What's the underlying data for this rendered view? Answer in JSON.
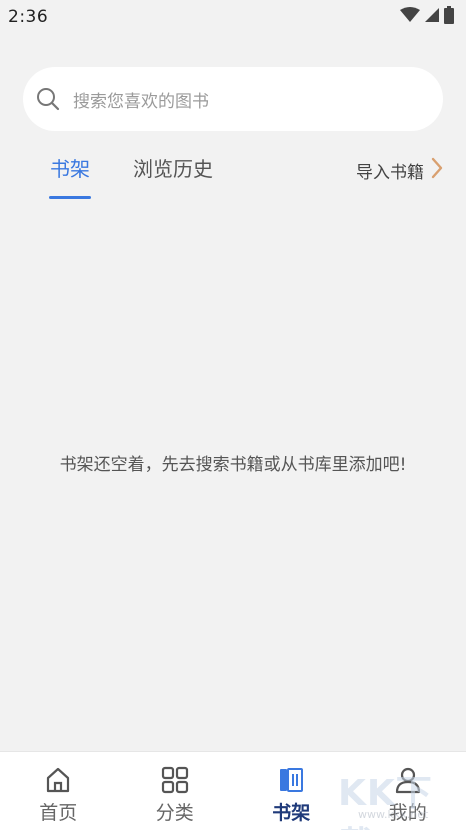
{
  "status_bar": {
    "time": "2:36",
    "icons": [
      "wifi-icon",
      "signal-icon",
      "battery-icon"
    ]
  },
  "search": {
    "placeholder": "搜索您喜欢的图书",
    "icon": "search-icon"
  },
  "tabs": [
    {
      "label": "书架",
      "active": true
    },
    {
      "label": "浏览历史",
      "active": false
    }
  ],
  "import": {
    "label": "导入书籍",
    "icon": "chevron-right-icon"
  },
  "empty_state": {
    "message": "书架还空着，先去搜索书籍或从书库里添加吧!"
  },
  "bottom_nav": [
    {
      "label": "首页",
      "icon": "home-icon",
      "active": false
    },
    {
      "label": "分类",
      "icon": "grid-icon",
      "active": false
    },
    {
      "label": "书架",
      "icon": "bookshelf-icon",
      "active": true
    },
    {
      "label": "我的",
      "icon": "user-icon",
      "active": false
    }
  ],
  "watermark": {
    "text": "KK下载",
    "url": "www.kkx.net"
  },
  "colors": {
    "accent": "#3a78e0",
    "active_nav": "#1f3a7a",
    "background": "#f2f2f2",
    "import_chevron": "#d9a070"
  }
}
